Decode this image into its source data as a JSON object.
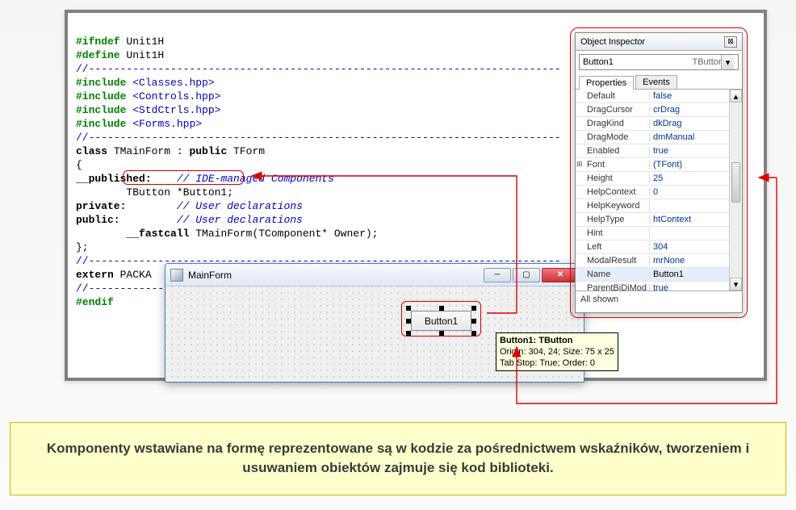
{
  "code": {
    "ifndef": "#ifndef",
    "define": "#define",
    "unit": "Unit1H",
    "include": "#include",
    "inc1": "<Classes.hpp>",
    "inc2": "<Controls.hpp>",
    "inc3": "<StdCtrls.hpp>",
    "inc4": "<Forms.hpp>",
    "class_kw": "class",
    "class_decl": " TMainForm : ",
    "public_kw": "public",
    "tform": " TForm",
    "brace_open": "{",
    "published": "__published:",
    "cmt_ide": "// IDE-managed Components",
    "tbutton_line_pre": "        TButton ",
    "tbutton_line_mid": "*Button1;",
    "private": "private:",
    "cmt_user1": "// User declarations",
    "public": "public:",
    "cmt_user2": "// User declarations",
    "fastcall_pre": "        __fastcall",
    "fastcall_rest": " TMainForm(TComponent* Owner);",
    "brace_close": "};",
    "extern": "extern",
    "package": " PACKA",
    "endif": "#endif",
    "dashes": "//---------------------------------------------------------------------------"
  },
  "form": {
    "title": "MainForm",
    "button_caption": "Button1"
  },
  "tooltip": {
    "l1": "Button1: TButton",
    "l2": "Origin: 304, 24; Size: 75 x 25",
    "l3": "Tab Stop: True; Order: 0"
  },
  "inspector": {
    "title": "Object Inspector",
    "obj_name": "Button1",
    "obj_type": "TButton",
    "tab_props": "Properties",
    "tab_events": "Events",
    "status": "All shown",
    "props": [
      {
        "n": "Default",
        "v": "false"
      },
      {
        "n": "DragCursor",
        "v": "crDrag"
      },
      {
        "n": "DragKind",
        "v": "dkDrag"
      },
      {
        "n": "DragMode",
        "v": "dmManual"
      },
      {
        "n": "Enabled",
        "v": "true"
      },
      {
        "n": "Font",
        "v": "(TFont)",
        "expand": true
      },
      {
        "n": "Height",
        "v": "25"
      },
      {
        "n": "HelpContext",
        "v": "0"
      },
      {
        "n": "HelpKeyword",
        "v": ""
      },
      {
        "n": "HelpType",
        "v": "htContext"
      },
      {
        "n": "Hint",
        "v": ""
      },
      {
        "n": "Left",
        "v": "304"
      },
      {
        "n": "ModalResult",
        "v": "mrNone"
      },
      {
        "n": "Name",
        "v": "Button1",
        "sel": true,
        "black": true
      },
      {
        "n": "ParentBiDiMod",
        "v": "true"
      }
    ]
  },
  "note": "Komponenty wstawiane na formę reprezentowane są w kodzie za pośrednictwem wskaźników, tworzeniem i usuwaniem obiektów zajmuje się kod biblioteki."
}
